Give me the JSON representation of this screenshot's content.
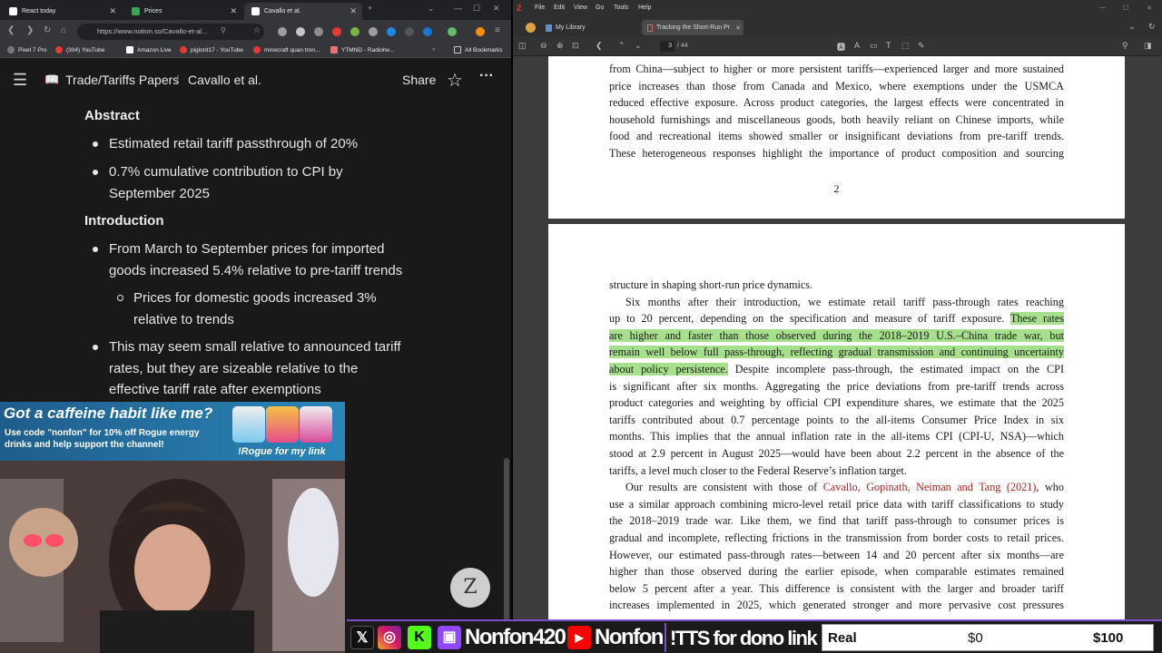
{
  "browser": {
    "tabs": [
      {
        "label": "React today",
        "color": "#ffffff",
        "active": false
      },
      {
        "label": "Prices",
        "color": "#34a853",
        "active": false
      },
      {
        "label": "Cavallo et al.",
        "color": "#ffffff",
        "active": true
      }
    ],
    "url": "https://www.notion.so/Cavallo-et-al...",
    "bookmarks": [
      "Pixel 7 Pro",
      "(304) YouTube",
      "Amazon Live",
      "piglord17 - YouTube",
      "minecraft quan tron...",
      "YTMND - Radiohe...",
      "All Bookmarks"
    ]
  },
  "notion": {
    "breadcrumb": [
      "Trade/Tariffs Papers",
      "Cavallo et al."
    ],
    "share_label": "Share",
    "abstract_heading": "Abstract",
    "abstract_bullets": [
      [
        "Estimated retail tariff passthrough of 20%"
      ],
      [
        "0.7% cumulative contribution to CPI by",
        "September 2025"
      ]
    ],
    "intro_heading": "Introduction",
    "intro_bullet1": [
      "From March to September prices for imported",
      "goods increased 5.4% relative to pre-tariff trends"
    ],
    "intro_sub_bullet": [
      "Prices for domestic goods increased 3%",
      "relative to trends"
    ],
    "intro_bullet2": [
      "This may seem small relative to announced tariff",
      "rates, but they are sizeable relative to the",
      "effective tariff rate after exemptions"
    ]
  },
  "overlay": {
    "ad_title": "Got a caffeine habit like me?",
    "ad_body": "Use code \"nonfon\" for 10% off Rogue energy drinks and help support the channel!",
    "ad_cta": "!Rogue for my link",
    "zbutton": "Z"
  },
  "zotero": {
    "menu": [
      "File",
      "Edit",
      "View",
      "Go",
      "Tools",
      "Help"
    ],
    "library_tab": "My Library",
    "doc_tab": "Tracking the Short-Run Pr",
    "page_current": "3",
    "page_total": "/ 44",
    "page2_lines": [
      "from China—subject to higher or more persistent tariffs—experienced larger and more sustained",
      "price increases than those from Canada and Mexico, where exemptions under the USMCA",
      "reduced effective exposure. Across product categories, the largest effects were concentrated in",
      "household furnishings and miscellaneous goods, both heavily reliant on Chinese imports, while",
      "food and recreational items showed smaller or insignificant deviations from pre-tariff trends.",
      "These heterogeneous responses highlight the importance of product composition and sourcing"
    ],
    "page2_number": "2",
    "p3_l1": "structure in shaping short-run price dynamics.",
    "p3_l2": "Six months after their introduction, we estimate retail tariff pass-through rates reaching",
    "p3_l3a": "up to 20 percent, depending on the specification and measure of tariff exposure. ",
    "p3_l3b": "These rates",
    "p3_l4": "are higher and faster than those observed during the 2018–2019 U.S.–China trade war, but",
    "p3_l5": "remain well below full pass-through, reflecting gradual transmission and continuing uncertainty",
    "p3_l6a": "about policy persistence.",
    "p3_l6b": " Despite incomplete pass-through, the estimated impact on the CPI",
    "p3_l7": "is significant after six months.  Aggregating the price deviations from pre-tariff trends across",
    "p3_l8": "product categories and weighting by official CPI expenditure shares, we estimate that the 2025",
    "p3_l9": "tariffs contributed about 0.7 percentage points to the all-items Consumer Price Index in six",
    "p3_l10": "months.  This implies that the annual inflation rate in the all-items CPI (CPI-U, NSA)—which",
    "p3_l11": "stood at 2.9 percent in August 2025—would have been about 2.2 percent in the absence of the",
    "p3_l12": "tariffs, a level much closer to the Federal Reserve’s inflation target.",
    "p3_l13a": "Our results are consistent with those of ",
    "p3_l13b": "Cavallo, Gopinath, Neiman and Tang (2021)",
    "p3_l13c": ", who",
    "p3_l14": "use a similar approach combining micro-level retail price data with tariff classifications to study",
    "p3_l15": "the 2018–2019 trade war.  Like them, we find that tariff pass-through to consumer prices is",
    "p3_l16": "gradual and incomplete, reflecting frictions in the transmission from border costs to retail prices.",
    "p3_l17": "However, our estimated pass-through rates—between 14 and 20 percent after six months—are",
    "p3_l18": "higher than those observed during the earlier episode, when comparable estimates remained",
    "p3_l19": "below 5 percent after a year.  This difference is consistent with the larger and broader tariff",
    "p3_l20": "increases implemented in 2025, which generated stronger and more pervasive cost pressures",
    "highlight_color": "#a7e08c",
    "citation_color": "#b22222"
  },
  "bottombar": {
    "handle1": "Nonfon420",
    "handle2": "Nonfon",
    "tts": "!TTS for dono link",
    "meter_label": "Real",
    "meter_current": "$0",
    "meter_goal": "$100",
    "accent": "#7a4fc9"
  }
}
